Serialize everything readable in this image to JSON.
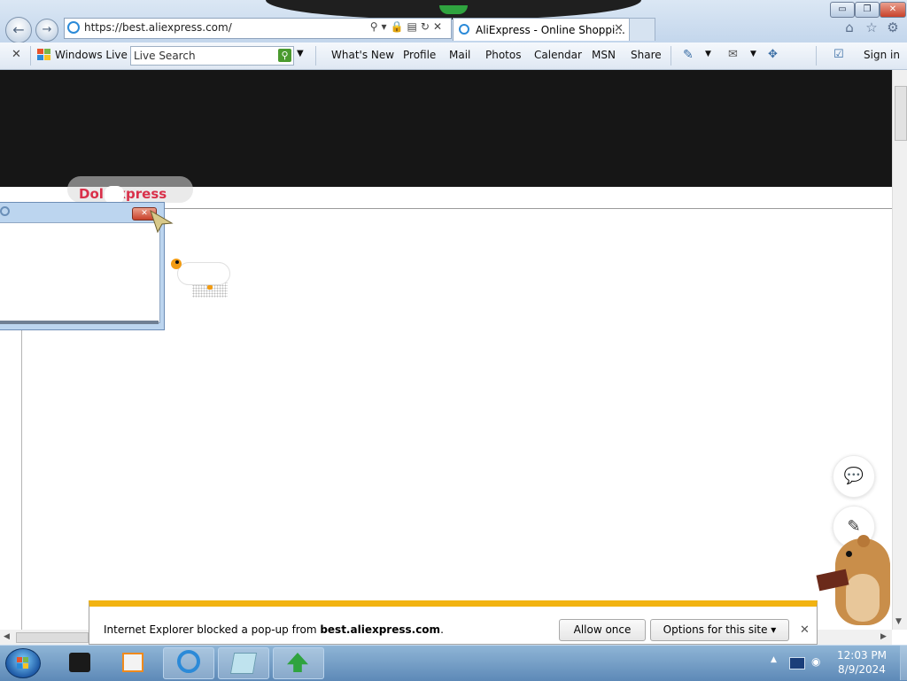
{
  "browser": {
    "address_url": "https://best.aliexpress.com/",
    "tab_title": "AliExpress - Online Shoppi...",
    "window_buttons": {
      "minimize": "▭",
      "maximize": "❐",
      "close": "✕"
    },
    "icons": {
      "back": "arrow-left-icon",
      "forward": "arrow-right-icon",
      "home": "home-icon",
      "favorites": "star-icon",
      "tools": "gear-icon"
    }
  },
  "command_bar": {
    "close_glyph": "✕",
    "windows_live": "Windows Live",
    "search_placeholder": "Live Search",
    "links": [
      "What's New",
      "Profile",
      "Mail",
      "Photos",
      "Calendar",
      "MSN",
      "Share"
    ],
    "sign_in": "Sign in"
  },
  "page": {
    "brand_text": "Dol   Express",
    "colors": {
      "banner": "#161616",
      "brand": "#d9304a",
      "notify_accent": "#f2b311"
    }
  },
  "popup_window": {
    "close_glyph": "✕"
  },
  "floating_buttons": {
    "chat_icon": "💬",
    "edit_icon": "✎"
  },
  "notification": {
    "message_prefix": "Internet Explorer blocked a pop-up from ",
    "site": "best.aliexpress.com",
    "message_suffix": ".",
    "allow_once": "Allow once",
    "options": "Options for this site ▾",
    "close_glyph": "✕"
  },
  "taskbar": {
    "time": "12:03 PM",
    "date": "8/9/2024"
  }
}
